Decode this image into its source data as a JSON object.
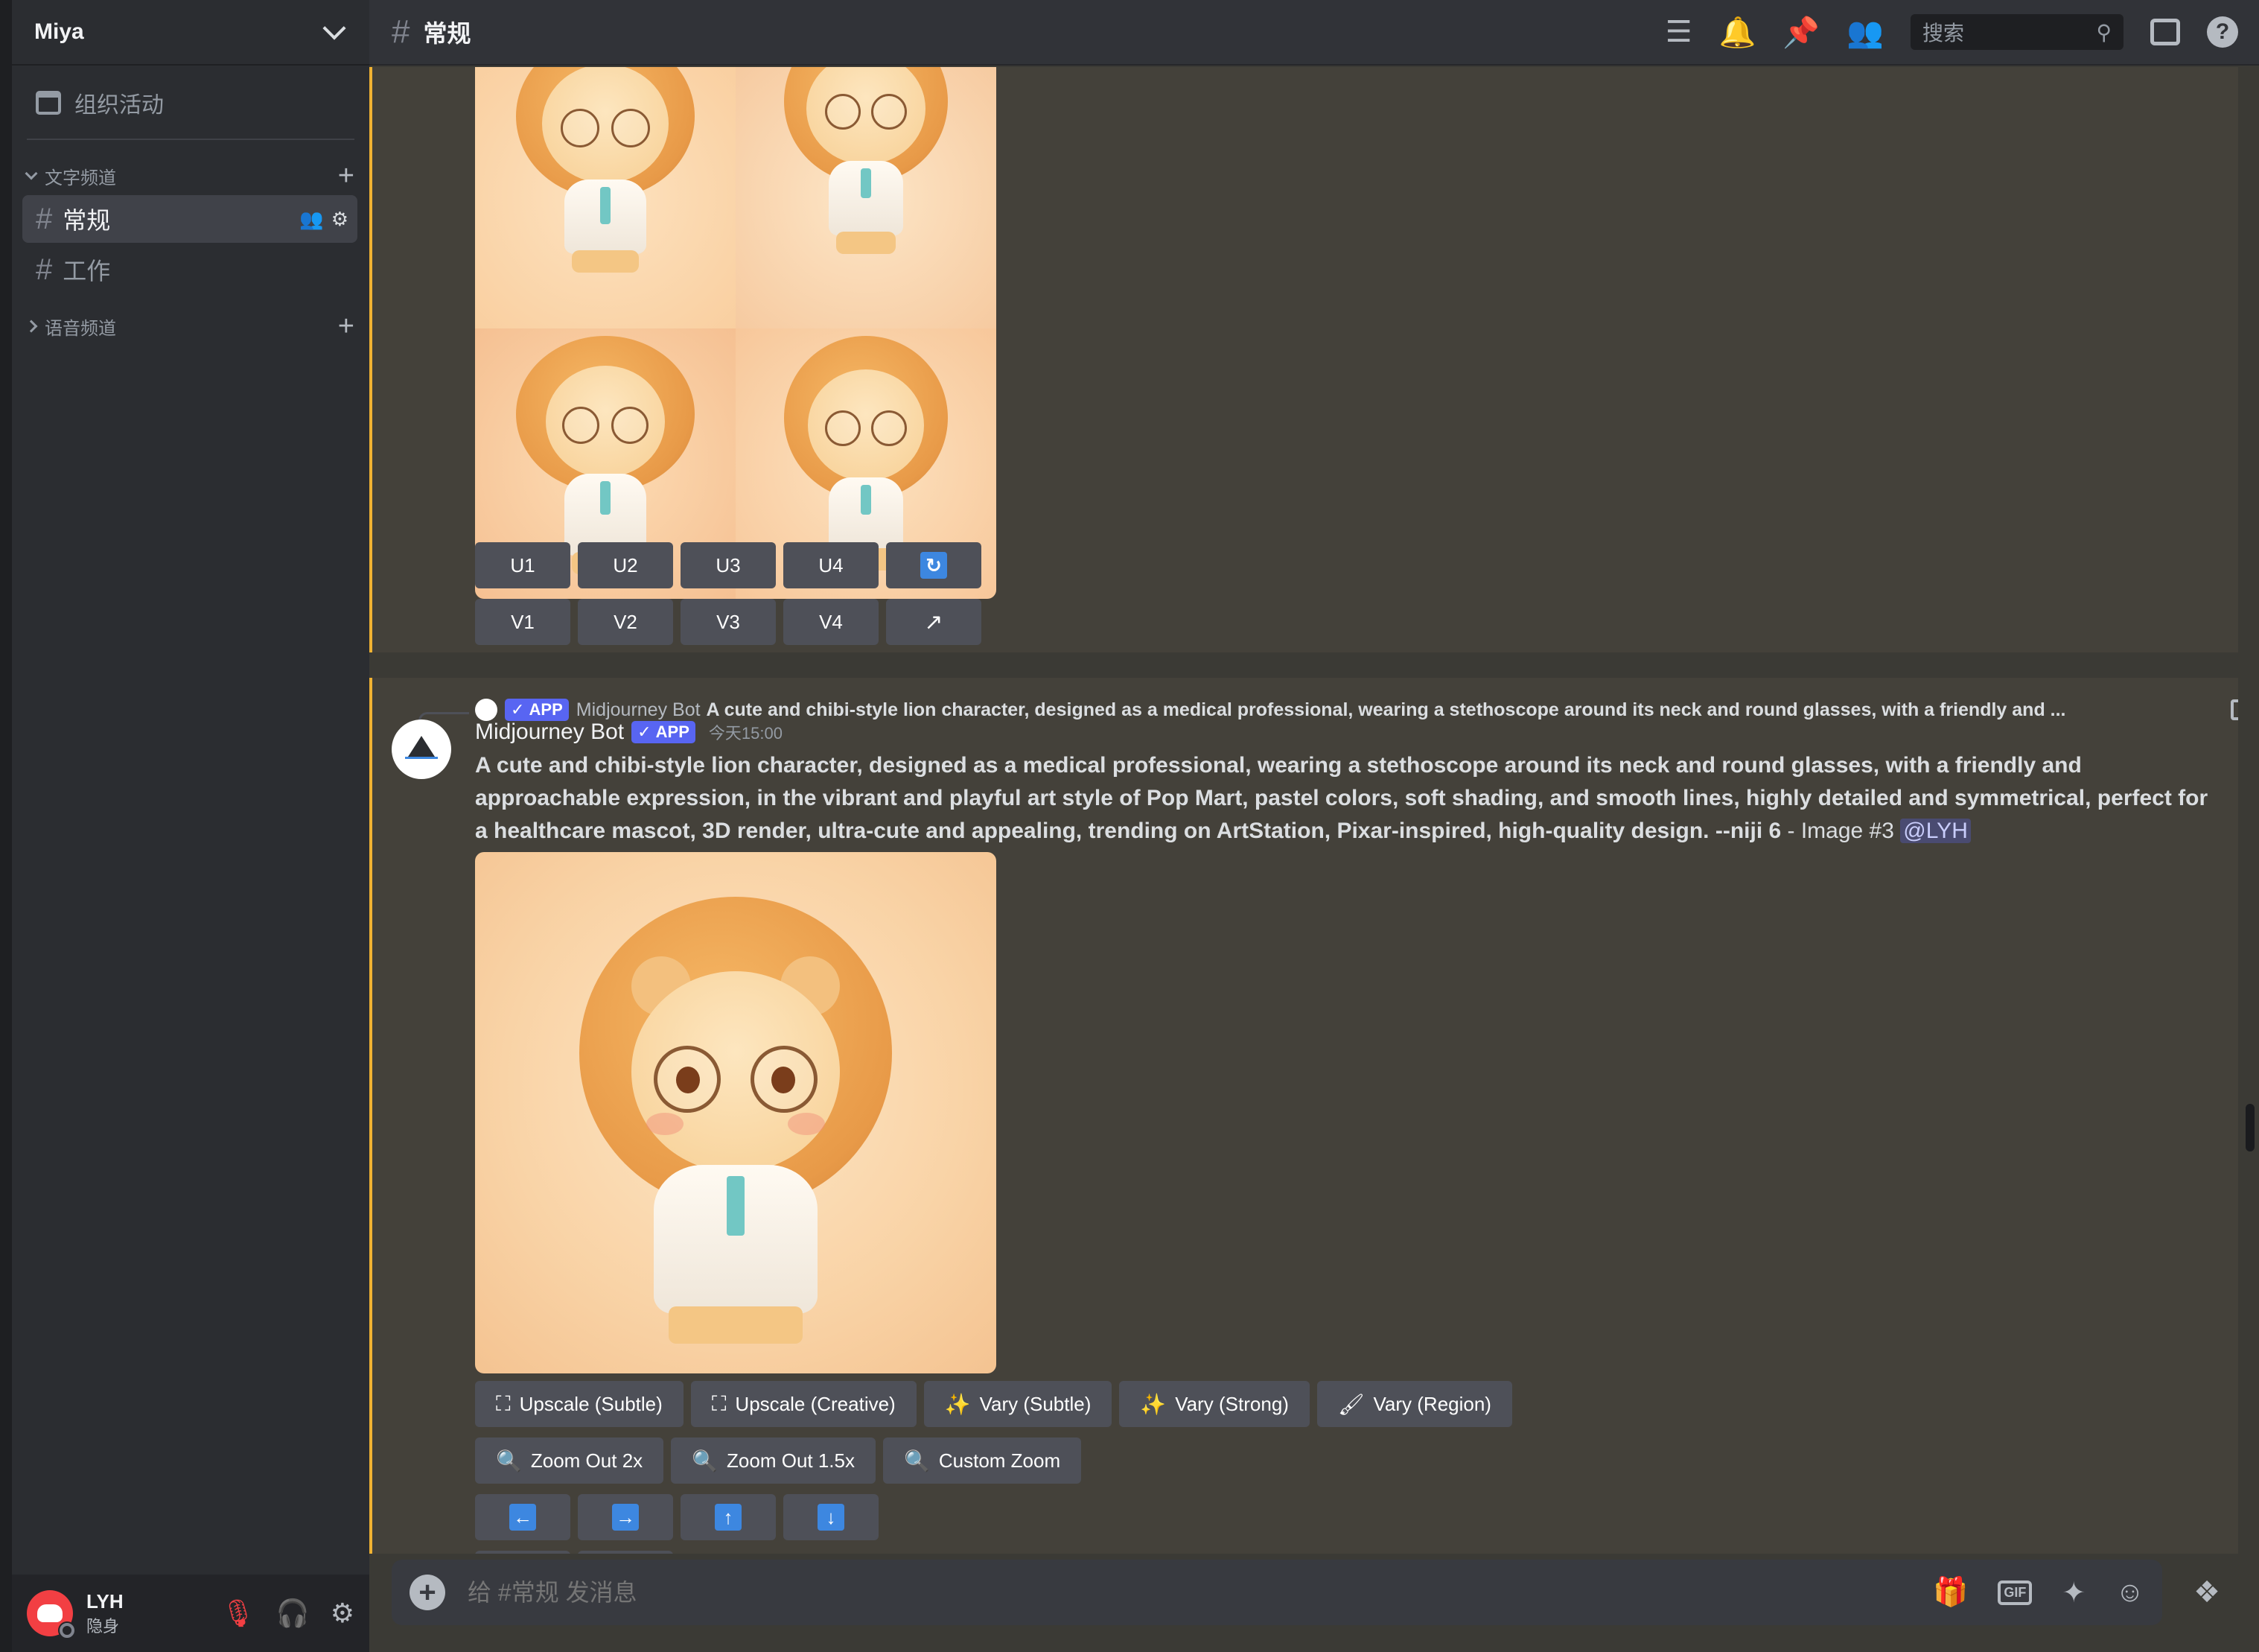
{
  "server": {
    "name": "Miya",
    "events_label": "组织活动"
  },
  "categories": [
    {
      "label": "文字频道",
      "expanded": true
    },
    {
      "label": "语音频道",
      "expanded": false
    }
  ],
  "channels": [
    {
      "name": "常规",
      "active": true
    },
    {
      "name": "工作",
      "active": false
    }
  ],
  "user": {
    "name": "LYH",
    "status": "隐身"
  },
  "topbar": {
    "channel": "常规",
    "search_placeholder": "搜索"
  },
  "message1": {
    "buttons_row1": [
      "U1",
      "U2",
      "U3",
      "U4"
    ],
    "buttons_row2": [
      "V1",
      "V2",
      "V3",
      "V4"
    ]
  },
  "message2": {
    "reply_bot_name": "Midjourney Bot",
    "reply_text": "A cute and chibi-style lion character, designed as a medical professional, wearing a stethoscope around its neck and round glasses, with a friendly and ...",
    "app_tag": "APP",
    "bot_name": "Midjourney Bot",
    "timestamp": "今天15:00",
    "prompt_bold": "A cute and chibi-style lion character, designed as a medical professional, wearing a stethoscope around its neck and round glasses, with a friendly and approachable expression, in the vibrant and playful art style of Pop Mart, pastel colors, soft shading, and smooth lines, highly detailed and symmetrical, perfect for a healthcare mascot, 3D render, ultra-cute and appealing, trending on ArtStation, Pixar-inspired, high-quality design. --niji 6",
    "prompt_suffix": " - Image #3 ",
    "mention": "@LYH",
    "buttons_row1": [
      "Upscale (Subtle)",
      "Upscale (Creative)",
      "Vary (Subtle)",
      "Vary (Strong)",
      "Vary (Region)"
    ],
    "buttons_row2": [
      "Zoom Out 2x",
      "Zoom Out 1.5x",
      "Custom Zoom"
    ]
  },
  "composer": {
    "placeholder": "给 #常规 发消息"
  },
  "colors": {
    "accent_highlight": "#f0b232",
    "blurple": "#5865f2",
    "arrow_blue": "#3d87e0"
  }
}
